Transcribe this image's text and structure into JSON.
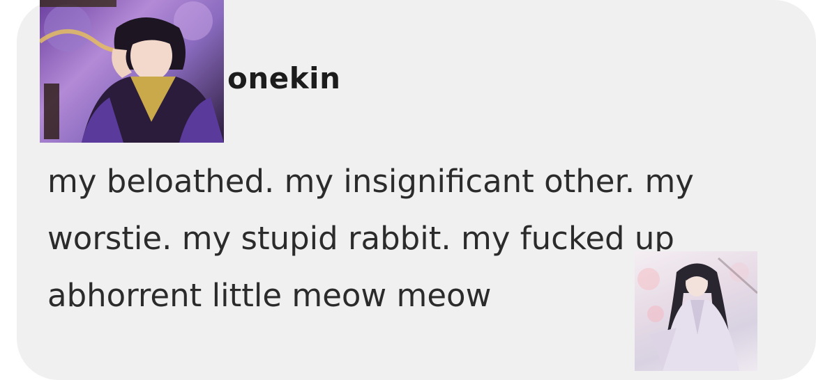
{
  "post": {
    "username": "onekin",
    "body": "my beloathed. my insignificant other. my\nworstie. my stupid rabbit. my fucked up\nabhorrent little meow meow"
  },
  "avatar": {
    "icon": "anime-character-avatar-icon"
  },
  "sticker": {
    "icon": "anime-character-sticker-icon"
  },
  "colors": {
    "card_background": "#f0f0f0",
    "text": "#2b2b2b",
    "username": "#1c1c1c"
  }
}
